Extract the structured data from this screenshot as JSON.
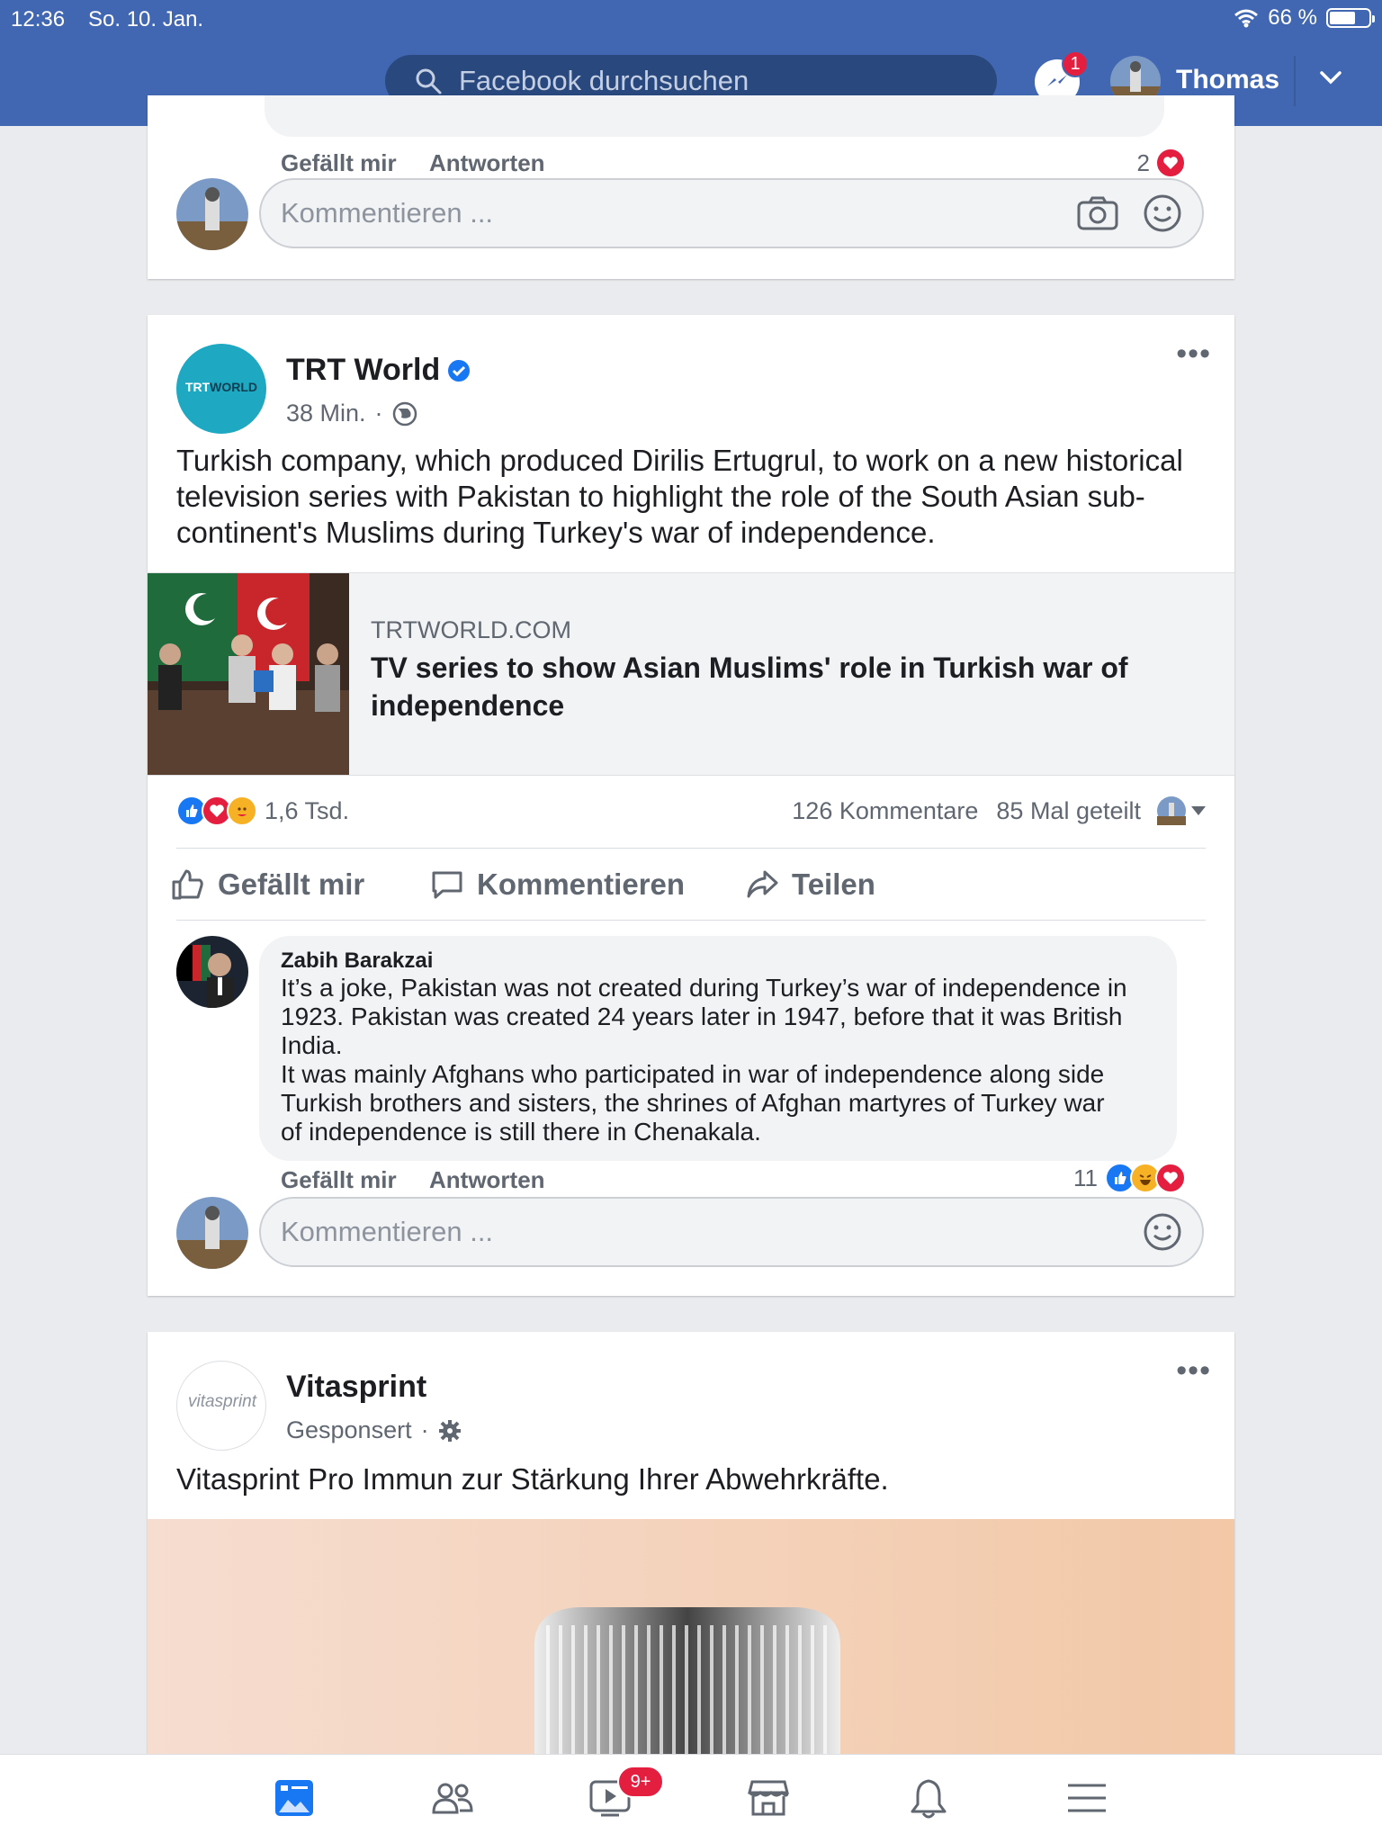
{
  "status_bar": {
    "time": "12:36",
    "date": "So. 10. Jan.",
    "battery": "66 %",
    "battery_level": 0.66
  },
  "header": {
    "search_placeholder": "Facebook durchsuchen",
    "messenger_badge": "1",
    "user_name": "Thomas"
  },
  "prev_comment": {
    "like_label": "Gefällt mir",
    "reply_label": "Antworten",
    "reaction_count": "2",
    "input_placeholder": "Kommentieren ..."
  },
  "trt_post": {
    "page_name": "TRT World",
    "avatar_text": [
      "TRT",
      "WORLD"
    ],
    "time": "38 Min.",
    "text": "Turkish company, which produced Dirilis Ertugrul, to work on a new historical television series with Pakistan to highlight the role of the South Asian sub-continent's Muslims during Turkey's war of independence.",
    "link": {
      "domain": "TRTWORLD.COM",
      "title": "TV series to show Asian Muslims' role in Turkish war of independence"
    },
    "reactions_count": "1,6 Tsd.",
    "comments_count": "126 Kommentare",
    "shares_count": "85 Mal geteilt",
    "actions": {
      "like": "Gefällt mir",
      "comment": "Kommentieren",
      "share": "Teilen"
    },
    "comment": {
      "author": "Zabih Barakzai",
      "lines": [
        "It’s a joke, Pakistan was not created during Turkey’s war of independence in",
        "1923. Pakistan was created 24 years later in 1947, before that it was British",
        "India.",
        "It was mainly Afghans who participated in war of independence along side",
        "Turkish brothers and sisters, the shrines of Afghan martyres of Turkey war",
        "of independence is still there in Chenakala."
      ],
      "like_label": "Gefällt mir",
      "reply_label": "Antworten",
      "reaction_count": "11"
    },
    "input_placeholder": "Kommentieren ..."
  },
  "ad_post": {
    "page_name": "Vitasprint",
    "avatar_text": "vitasprint",
    "sponsored": "Gesponsert",
    "text": "Vitasprint Pro Immun zur Stärkung Ihrer Abwehrkräfte."
  },
  "tabbar": {
    "watch_badge": "9+"
  },
  "colors": {
    "brand": "#4267b2",
    "like_blue": "#1877f2",
    "love_red": "#e41e3f"
  }
}
